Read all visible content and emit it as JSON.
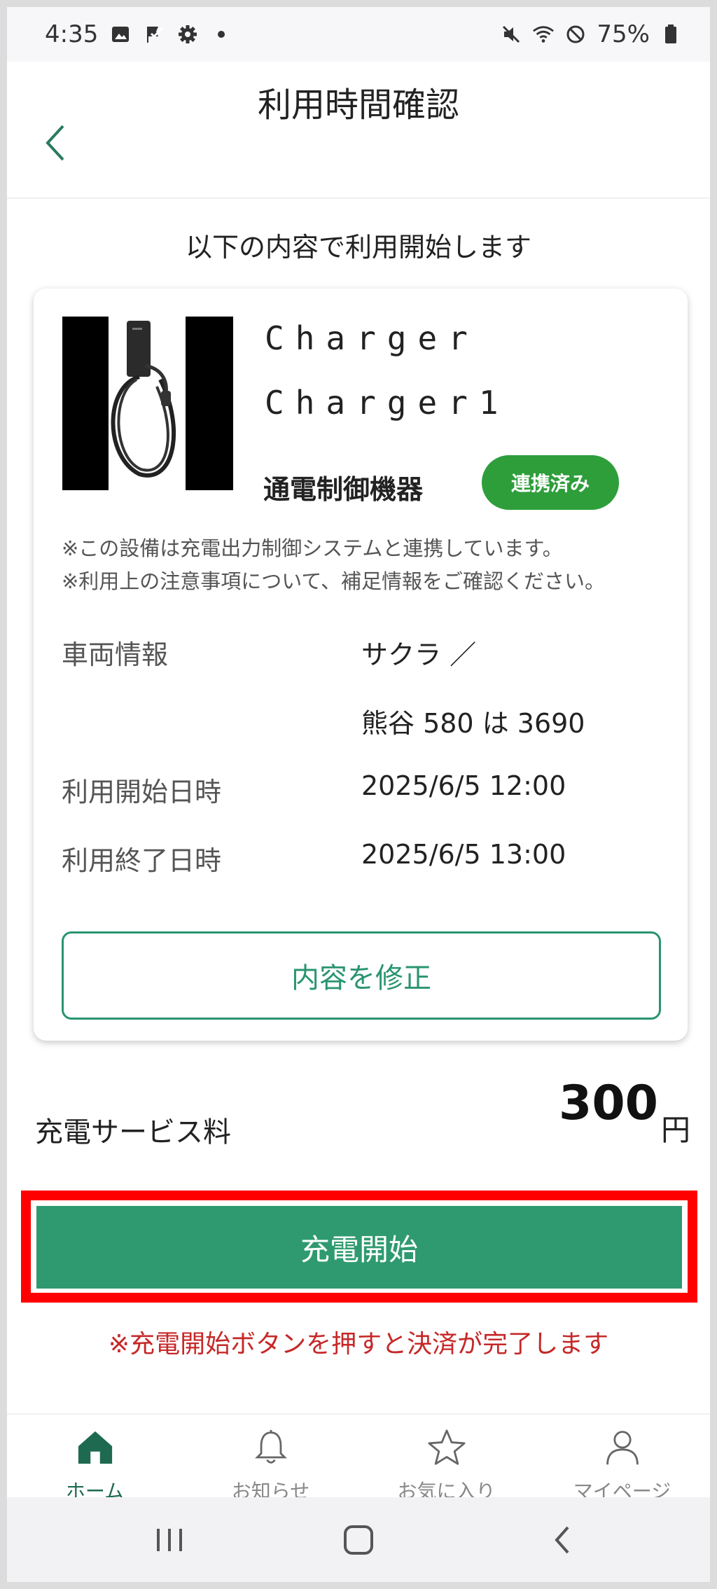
{
  "status_bar": {
    "time": "4:35",
    "battery": "75%"
  },
  "header": {
    "title": "利用時間確認"
  },
  "subtitle": "以下の内容で利用開始します",
  "device": {
    "name_line1": "Charger",
    "name_line2": "Charger1",
    "type": "通電制御機器",
    "badge": "連携済み",
    "note1": "※この設備は充電出力制御システムと連携しています。",
    "note2": "※利用上の注意事項について、補足情報をご確認ください。"
  },
  "info": {
    "vehicle_label": "車両情報",
    "vehicle_value1": "サクラ ／",
    "vehicle_value2": "熊谷 580 は 3690",
    "start_label": "利用開始日時",
    "start_value": "2025/6/5 12:00",
    "end_label": "利用終了日時",
    "end_value": "2025/6/5 13:00"
  },
  "edit_button": "内容を修正",
  "fee": {
    "label": "充電サービス料",
    "amount": "300",
    "unit": "円"
  },
  "start_button": "充電開始",
  "warning": "※充電開始ボタンを押すと決済が完了します",
  "tabs": [
    {
      "label": "ホーム",
      "icon": "home-icon"
    },
    {
      "label": "お知らせ",
      "icon": "bell-icon"
    },
    {
      "label": "お気に入り",
      "icon": "star-icon"
    },
    {
      "label": "マイページ",
      "icon": "person-icon"
    }
  ],
  "colors": {
    "primary": "#2f9a70",
    "badge": "#2e9e3b",
    "warning": "#c62828",
    "highlight": "#ff0000"
  }
}
